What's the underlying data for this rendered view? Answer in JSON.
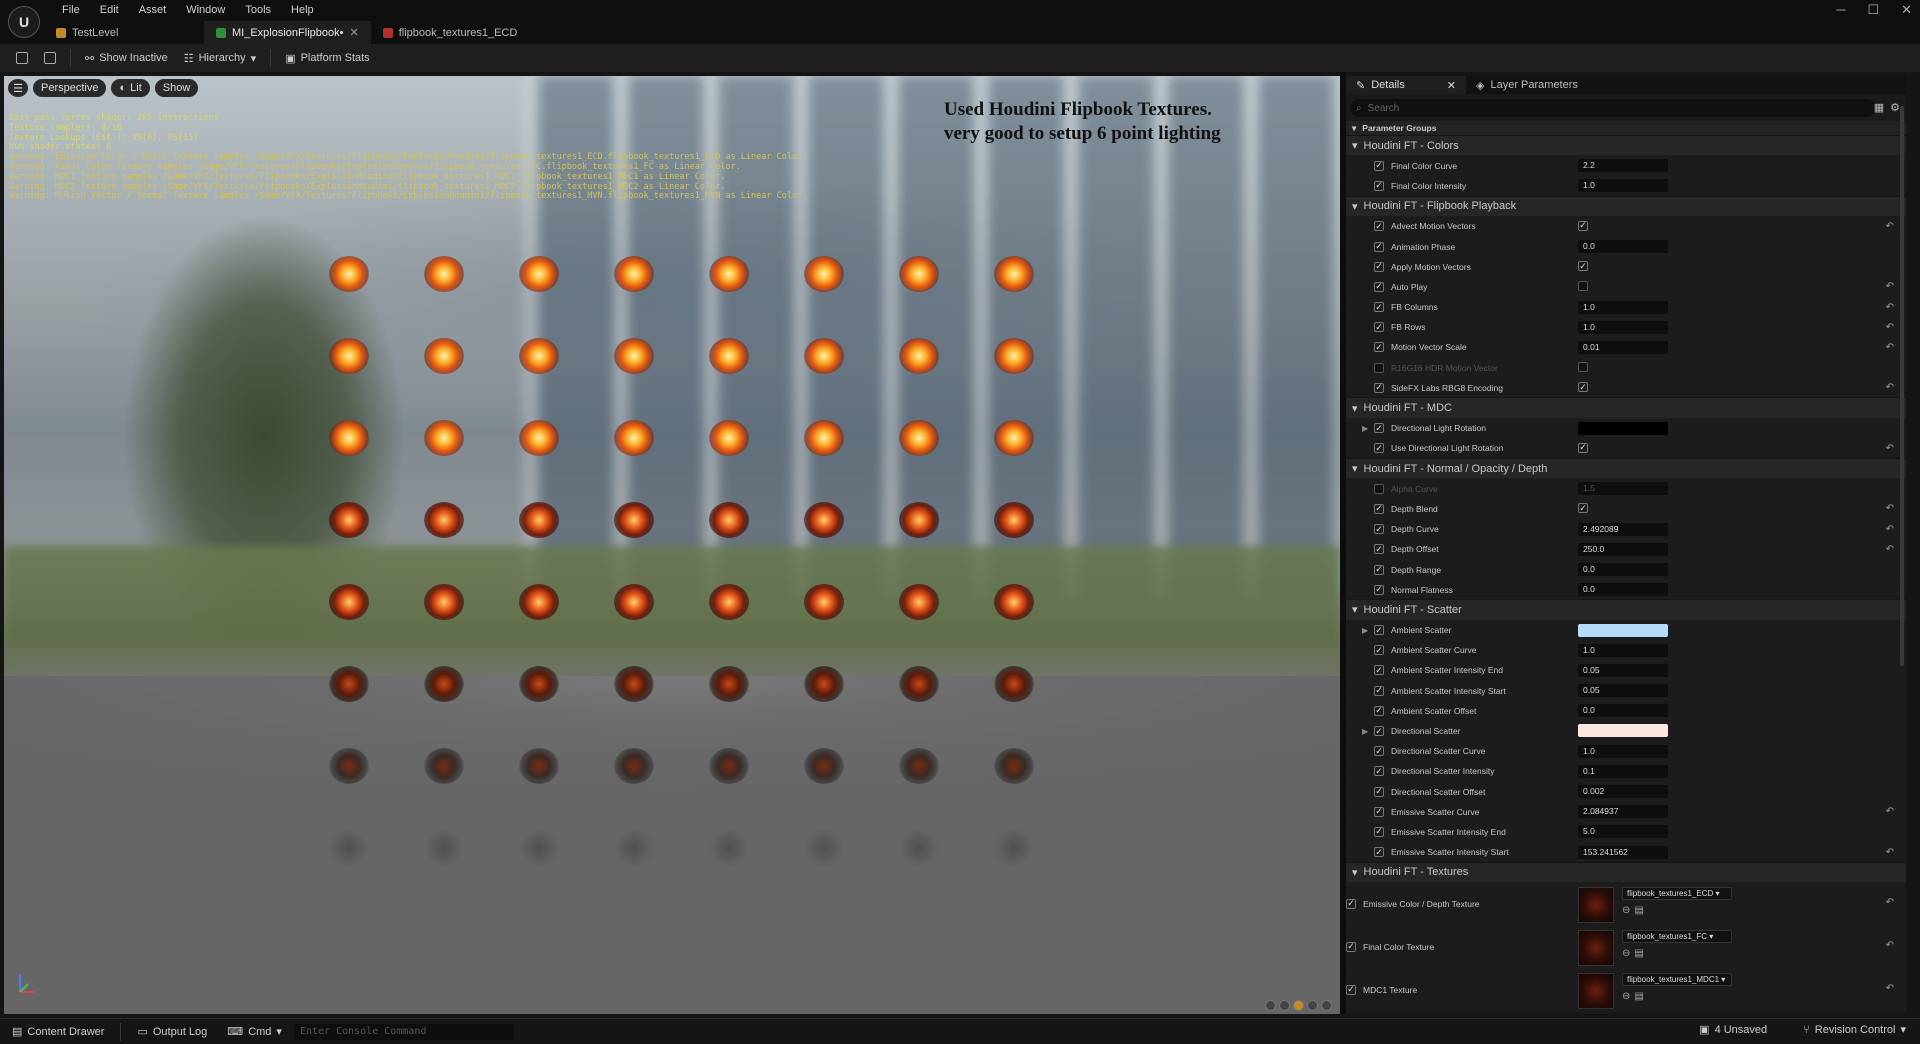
{
  "app": {
    "logo": "U",
    "menu": [
      "File",
      "Edit",
      "Asset",
      "Window",
      "Tools",
      "Help"
    ],
    "tabs": [
      {
        "label": "TestLevel",
        "icon": "level-icon"
      },
      {
        "label": "MI_ExplosionFlipbook•",
        "icon": "material-instance-icon",
        "active": true
      },
      {
        "label": "flipbook_textures1_ECD",
        "icon": "texture-icon"
      }
    ],
    "window_controls": [
      "─",
      "☐",
      "✕"
    ]
  },
  "toolbar": {
    "show_inactive": "Show Inactive",
    "hierarchy": "Hierarchy",
    "platform_stats": "Platform Stats"
  },
  "viewport": {
    "perspective": "Perspective",
    "lit": "Lit",
    "show": "Show",
    "stats": [
      {
        "t": "Base pass vertex shader: 295 instructions",
        "c": "g"
      },
      {
        "t": "Texture samplers: 8/16",
        "c": "g"
      },
      {
        "t": "Texture Lookups (Est.): VS(0), PS(15)",
        "c": "g"
      },
      {
        "t": "Num shader states: 8",
        "c": "g"
      },
      {
        "t": "Warning: Emissive Color / Depth Texture samples /Game/VFX/Textures/Flipbooks/ExplosionHoudini/flipbook_textures1_ECD.flipbook_textures1_ECD as Linear Color.",
        "c": "w"
      },
      {
        "t": "Warning: Final Color Texture samples /Game/VFX/Textures/Flipbooks/ExplosionHoudini/flipbook_textures1_FC.flipbook_textures1_FC as Linear Color.",
        "c": "w"
      },
      {
        "t": "Warning: MDC1 Texture samples /Game/VFX/Textures/Flipbooks/ExplosionHoudini/flipbook_textures1_MDC1.flipbook_textures1_MDC1 as Linear Color.",
        "c": "w"
      },
      {
        "t": "Warning: MDC2 Texture samples /Game/VFX/Textures/Flipbooks/ExplosionHoudini/flipbook_textures1_MDC2.flipbook_textures1_MDC2 as Linear Color.",
        "c": "w"
      },
      {
        "t": "Warning: Motion Vector / Normal Texture samples /Game/VFX/Textures/Flipbooks/ExplosionHoudini/flipbook_textures1_MVN.flipbook_textures1_MVN as Linear Color.",
        "c": "w"
      }
    ],
    "note_line1": "Used Houdini Flipbook Textures.",
    "note_line2": "very good to setup 6 point lighting",
    "flipbook_grid": {
      "rows": 8,
      "cols": 8
    }
  },
  "panel": {
    "tabs": [
      {
        "label": "Details"
      },
      {
        "label": "Layer Parameters"
      }
    ],
    "search_placeholder": "Search",
    "parameter_groups": "Parameter Groups",
    "sections": [
      {
        "title": "Houdini FT - Colors",
        "rows": [
          {
            "label": "Final Color Curve",
            "value": "2.2"
          },
          {
            "label": "Final Color Intensity",
            "value": "1.0"
          }
        ]
      },
      {
        "title": "Houdini FT - Flipbook Playback",
        "rows": [
          {
            "label": "Advect Motion Vectors",
            "bool": true,
            "reset": true
          },
          {
            "label": "Animation Phase",
            "value": "0.0"
          },
          {
            "label": "Apply Motion Vectors",
            "bool": true
          },
          {
            "label": "Auto Play",
            "bool": false,
            "reset": true
          },
          {
            "label": "FB Columns",
            "value": "1.0",
            "reset": true
          },
          {
            "label": "FB Rows",
            "value": "1.0",
            "reset": true
          },
          {
            "label": "Motion Vector Scale",
            "value": "0.01",
            "reset": true
          },
          {
            "label": "R16G16 HDR Motion Vector",
            "bool": false,
            "dim": true,
            "unchecked": true
          },
          {
            "label": "SideFX Labs RBG8 Encoding",
            "bool": true,
            "reset": true
          }
        ]
      },
      {
        "title": "Houdini FT - MDC",
        "rows": [
          {
            "label": "Directional Light Rotation",
            "color": "#000000",
            "expand": true
          },
          {
            "label": "Use Directional Light Rotation",
            "bool": true,
            "reset": true
          }
        ]
      },
      {
        "title": "Houdini FT - Normal / Opacity / Depth",
        "rows": [
          {
            "label": "Alpha Curve",
            "value": "1.5",
            "dim": true,
            "unchecked": true
          },
          {
            "label": "Depth Blend",
            "bool": true,
            "reset": true
          },
          {
            "label": "Depth Curve",
            "value": "2.492089",
            "reset": true
          },
          {
            "label": "Depth Offset",
            "value": "250.0",
            "reset": true
          },
          {
            "label": "Depth Range",
            "value": "0.0"
          },
          {
            "label": "Normal Flatness",
            "value": "0.0"
          }
        ]
      },
      {
        "title": "Houdini FT - Scatter",
        "rows": [
          {
            "label": "Ambient Scatter",
            "color": "#b4dcfa",
            "expand": true
          },
          {
            "label": "Ambient Scatter Curve",
            "value": "1.0"
          },
          {
            "label": "Ambient Scatter Intensity End",
            "value": "0.05"
          },
          {
            "label": "Ambient Scatter Intensity Start",
            "value": "0.05"
          },
          {
            "label": "Ambient Scatter Offset",
            "value": "0.0"
          },
          {
            "label": "Directional Scatter",
            "color": "#fce6e0",
            "expand": true
          },
          {
            "label": "Directional Scatter Curve",
            "value": "1.0"
          },
          {
            "label": "Directional Scatter Intensity",
            "value": "0.1"
          },
          {
            "label": "Directional Scatter Offset",
            "value": "0.002"
          },
          {
            "label": "Emissive Scatter Curve",
            "value": "2.084937",
            "reset": true
          },
          {
            "label": "Emissive Scatter Intensity End",
            "value": "5.0"
          },
          {
            "label": "Emissive Scatter Intensity Start",
            "value": "153.241562",
            "reset": true
          }
        ]
      },
      {
        "title": "Houdini FT - Textures",
        "textures": [
          {
            "label": "Emissive Color / Depth Texture",
            "asset": "flipbook_textures1_ECD"
          },
          {
            "label": "Final Color Texture",
            "asset": "flipbook_textures1_FC"
          },
          {
            "label": "MDC1 Texture",
            "asset": "flipbook_textures1_MDC1"
          }
        ]
      }
    ]
  },
  "statusbar": {
    "content_drawer": "Content Drawer",
    "output_log": "Output Log",
    "cmd": "Cmd",
    "console_placeholder": "Enter Console Command",
    "unsaved": "4 Unsaved",
    "revision_control": "Revision Control"
  }
}
